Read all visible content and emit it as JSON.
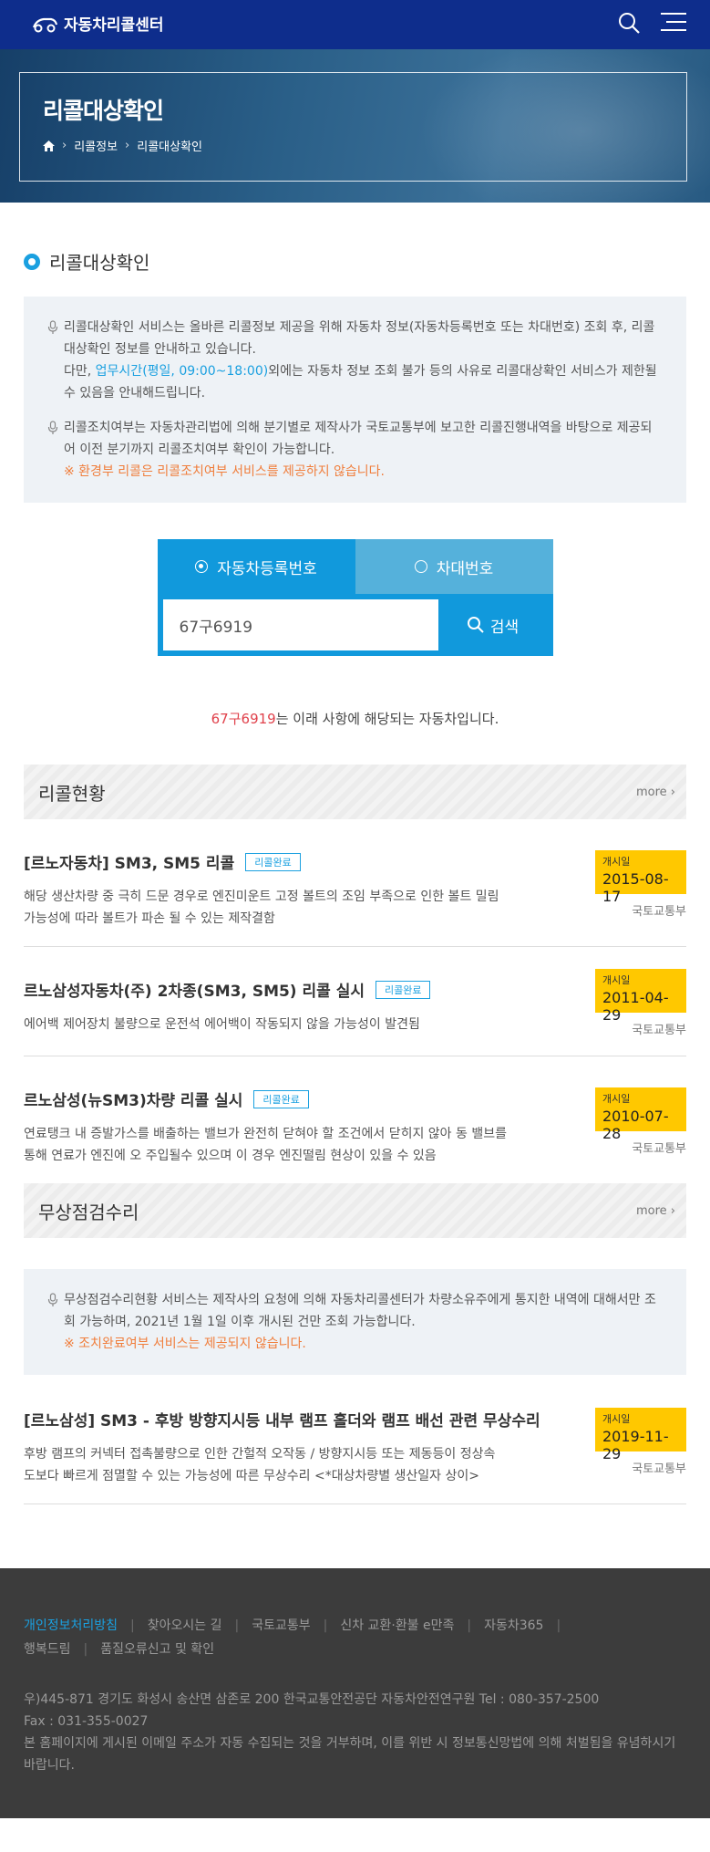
{
  "header": {
    "logo_text": "자동차리콜센터",
    "icons": [
      "search-icon",
      "menu-icon"
    ]
  },
  "hero": {
    "title": "리콜대상확인",
    "breadcrumb": [
      "home-icon",
      "리콜정보",
      "리콜대상확인"
    ]
  },
  "section": {
    "title": "리콜대상확인",
    "notice1_a": "리콜대상확인 서비스는 올바른 리콜정보 제공을 위해 자동차 정보(자동차등록번호 또는 차대번호) 조회 후, 리콜대상확인 정보를 안내하고 있습니다.",
    "notice1_b_pre": "다만, ",
    "notice1_b_hl": "업무시간(평일, 09:00~18:00)",
    "notice1_b_post": "외에는 자동차 정보 조회 불가 등의 사유로 리콜대상확인 서비스가 제한될 수 있음을 안내해드립니다.",
    "notice2_a": "리콜조치여부는 자동차관리법에 의해 분기별로 제작사가 국토교통부에 보고한 리콜진행내역을 바탕으로 제공되어 이전 분기까지 리콜조치여부 확인이 가능합니다.",
    "notice2_warn": "※ 환경부 리콜은 리콜조치여부 서비스를 제공하지 않습니다."
  },
  "search": {
    "tab_active": "자동차등록번호",
    "tab_inactive": "차대번호",
    "input_value": "67구6919",
    "button_label": "검색"
  },
  "result": {
    "plate": "67구6919",
    "text": "는 이래 사항에 해당되는 자동차입니다."
  },
  "recall": {
    "title": "리콜현황",
    "more": "more",
    "items": [
      {
        "title": "[르노자동차] SM3, SM5 리콜",
        "badge": "리콜완료",
        "desc": "해당 생산차량 중 극히 드문 경우로 엔진미운트 고정 볼트의 조임 부족으로 인한 볼트 밀림 가능성에 따라 볼트가 파손 될 수 있는 제작결함",
        "date_label": "개시일",
        "date": "2015-08-17",
        "org": "국토교통부"
      },
      {
        "title": "르노삼성자동차(주) 2차종(SM3, SM5) 리콜 실시",
        "badge": "리콜완료",
        "desc": "에어백 제어장치 불량으로 운전석 에어백이 작동되지 않을 가능성이 발견됨",
        "date_label": "개시일",
        "date": "2011-04-29",
        "org": "국토교통부"
      },
      {
        "title": "르노삼성(뉴SM3)차량 리콜 실시",
        "badge": "리콜완료",
        "desc": "연료탱크 내 증발가스를 배출하는 밸브가 완전히 닫혀야 할 조건에서 닫히지 않아 동 밸브를 통해 연료가 엔진에 오 주입될수 있으며 이 경우 엔진떨림 현상이 있을 수 있음",
        "date_label": "개시일",
        "date": "2010-07-28",
        "org": "국토교통부"
      }
    ]
  },
  "repair": {
    "title": "무상점검수리",
    "more": "more",
    "notice": "무상점검수리현황 서비스는 제작사의 요청에 의해 자동차리콜센터가 차량소유주에게 통지한 내역에 대해서만 조회 가능하며, 2021년 1월 1일 이후 개시된 건만 조회 가능합니다.",
    "warn": "※ 조치완료여부 서비스는 제공되지 않습니다.",
    "items": [
      {
        "title": "[르노삼성] SM3 - 후방 방향지시등 내부 램프 홀더와 램프 배선 관련 무상수리",
        "desc": "후방 램프의 커넥터 접촉불량으로 인한 간헐적 오작동 / 방향지시등 또는 제동등이 정상속도보다 빠르게 점멸할 수 있는 가능성에 따른 무상수리 <*대상차량별 생산일자 상이>",
        "date_label": "개시일",
        "date": "2019-11-29",
        "org": "국토교통부"
      }
    ]
  },
  "footer": {
    "links": [
      "개인정보처리방침",
      "찾아오시는 길",
      "국토교통부",
      "신차 교환·환불 e만족",
      "자동차365",
      "행복드림",
      "품질오류신고 및 확인"
    ],
    "address": "우)445-871 경기도 화성시 송산면 삼존로 200 한국교통안전공단 자동차안전연구원 Tel : 080-357-2500",
    "fax": "Fax : 031-355-0027",
    "disclaimer": "본 홈페이지에 게시된 이메일 주소가 자동 수집되는 것을 거부하며, 이를 위반 시 정보통신망법에 의해 처벌됨을 유념하시기 바랍니다."
  },
  "colors": {
    "header_bg": "#0e2d8c",
    "accent": "#1aa0e0",
    "date_badge": "#ffc800",
    "warn": "#f07e3c"
  }
}
